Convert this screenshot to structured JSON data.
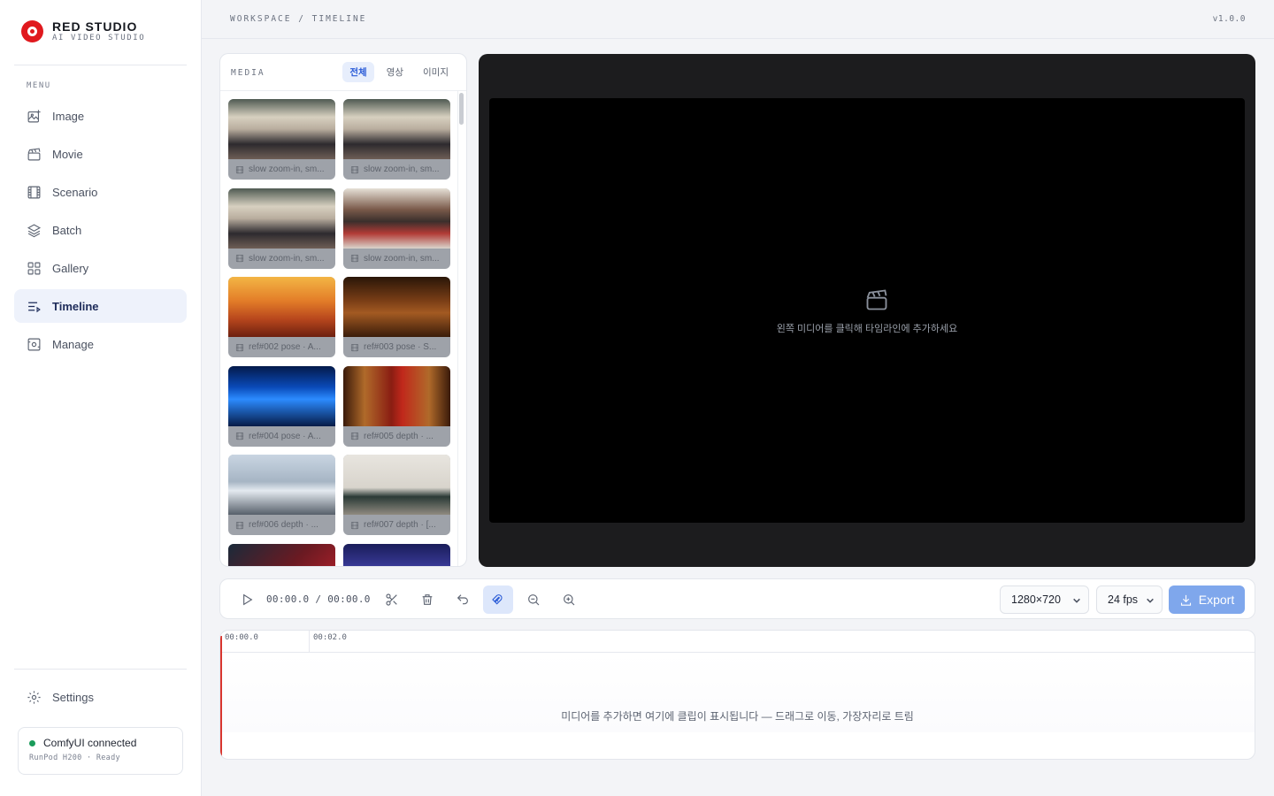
{
  "brand": {
    "name": "RED STUDIO",
    "subtitle": "AI VIDEO STUDIO"
  },
  "menu_label": "MENU",
  "nav": [
    {
      "label": "Image",
      "icon": "image-plus-icon"
    },
    {
      "label": "Movie",
      "icon": "clapperboard-icon"
    },
    {
      "label": "Scenario",
      "icon": "film-icon"
    },
    {
      "label": "Batch",
      "icon": "layers-icon"
    },
    {
      "label": "Gallery",
      "icon": "grid-icon"
    },
    {
      "label": "Timeline",
      "icon": "timeline-icon",
      "active": true
    },
    {
      "label": "Manage",
      "icon": "manage-icon"
    }
  ],
  "settings_label": "Settings",
  "status": {
    "title": "ComfyUI connected",
    "subtitle": "RunPod H200 · Ready",
    "color": "#1a9b5a"
  },
  "topbar": {
    "breadcrumb": "WORKSPACE / TIMELINE",
    "version": "v1.0.0"
  },
  "media": {
    "title": "MEDIA",
    "tabs": [
      {
        "label": "전체",
        "active": true
      },
      {
        "label": "영상"
      },
      {
        "label": "이미지"
      }
    ],
    "items": [
      {
        "caption": "slow zoom-in, sm...",
        "theme": "fur"
      },
      {
        "caption": "slow zoom-in, sm...",
        "theme": "fur"
      },
      {
        "caption": "slow zoom-in, sm...",
        "theme": "fur"
      },
      {
        "caption": "slow zoom-in, sm...",
        "theme": "diner"
      },
      {
        "caption": "ref#002 pose · A...",
        "theme": "mars"
      },
      {
        "caption": "ref#003 pose · S...",
        "theme": "hall"
      },
      {
        "caption": "ref#004 pose · A...",
        "theme": "neon"
      },
      {
        "caption": "ref#005 depth · ...",
        "theme": "stage"
      },
      {
        "caption": "ref#006 depth · ...",
        "theme": "beach"
      },
      {
        "caption": "ref#007 depth · [...",
        "theme": "studio"
      },
      {
        "caption": "",
        "theme": "red"
      },
      {
        "caption": "",
        "theme": "ballet"
      }
    ]
  },
  "preview": {
    "empty_text": "왼쪽 미디어를 클릭해 타임라인에 추가하세요"
  },
  "toolbar": {
    "time": "00:00.0 / 00:00.0",
    "resolution": "1280×720",
    "fps": "24 fps",
    "export_label": "Export"
  },
  "timeline": {
    "ticks": [
      "00:00.0",
      "00:02.0"
    ],
    "empty_text": "미디어를 추가하면 여기에 클립이 표시됩니다 — 드래그로 이동, 가장자리로 트림"
  },
  "colors": {
    "accent": "#2a5bd7",
    "brand": "#e0191e",
    "playhead": "#d9362f",
    "export": "#7fa7ec"
  }
}
